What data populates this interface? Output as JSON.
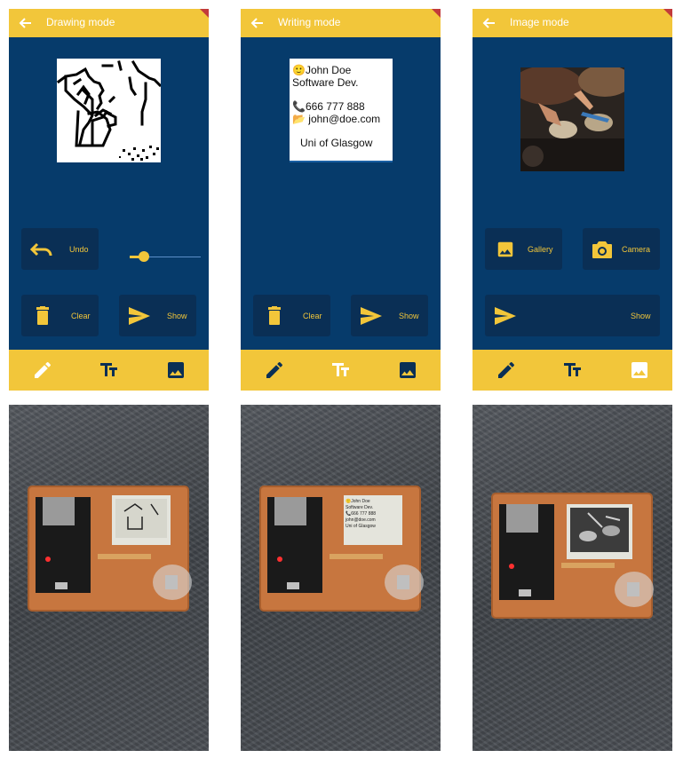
{
  "screens": [
    {
      "title": "Drawing mode",
      "buttons": {
        "undo": "Undo",
        "clear": "Clear",
        "show": "Show"
      }
    },
    {
      "title": "Writing mode",
      "card": {
        "line1": "🙂John Doe",
        "line2": "Software Dev.",
        "line3": "📞666 777 888",
        "line4": "📂 john@doe.com",
        "line5": "Uni of Glasgow"
      },
      "buttons": {
        "clear": "Clear",
        "show": "Show"
      }
    },
    {
      "title": "Image mode",
      "buttons": {
        "gallery": "Gallery",
        "camera": "Camera",
        "show": "Show"
      }
    }
  ],
  "photos": [
    {
      "display_card": {}
    },
    {
      "display_card": {
        "line1": "🙂John Doe",
        "line2": "Software Dev.",
        "line3": "📞666 777 888",
        "line4": "john@doe.com",
        "line5": "Uni of Glasgow"
      }
    },
    {
      "display_card": {}
    }
  ],
  "icons": {
    "back": "arrow-left-icon",
    "undo": "undo-icon",
    "trash": "trash-icon",
    "send": "send-icon",
    "pencil": "pencil-icon",
    "text": "text-format-icon",
    "image": "image-icon",
    "camera": "camera-icon"
  },
  "colors": {
    "primary": "#063b6b",
    "accent": "#f2c63a",
    "button_bg": "#0a2f55",
    "corner_badge": "#c23b3b"
  },
  "slider": {
    "value_fraction": 0.15
  },
  "nav_active": {
    "screen1": "pencil",
    "screen2": "text",
    "screen3": "image"
  }
}
